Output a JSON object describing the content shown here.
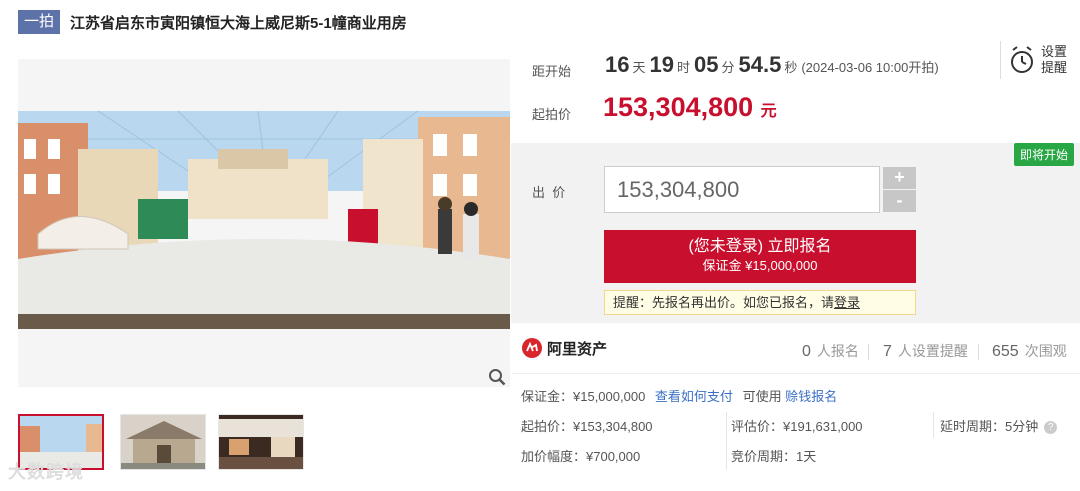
{
  "header": {
    "badge": "一拍",
    "title": "江苏省启东市寅阳镇恒大海上威尼斯5-1幢商业用房"
  },
  "countdown": {
    "label": "距开始",
    "days": "16",
    "days_unit": "天",
    "hours": "19",
    "hours_unit": "时",
    "minutes": "05",
    "minutes_unit": "分",
    "seconds": "54.5",
    "seconds_unit": "秒",
    "start_time": "(2024-03-06 10:00开拍)"
  },
  "start_price": {
    "label": "起拍价",
    "value": "153,304,800",
    "unit": "元"
  },
  "reminder": {
    "label_line1": "设置",
    "label_line2": "提醒",
    "icon": "alarm-clock-icon"
  },
  "bid": {
    "status_tag": "即将开始",
    "label": "出  价",
    "input_value": "153,304,800",
    "plus": "+",
    "minus": "-",
    "apply_main": "(您未登录) 立即报名",
    "apply_sub": "保证金 ¥15,000,000",
    "tip_text": "提醒：先报名再出价。如您已报名，请",
    "tip_link": "登录"
  },
  "brand": {
    "name": "阿里资产",
    "icon": "ali-asset-logo-icon"
  },
  "stats": {
    "applicants": "0",
    "applicants_label": "人报名",
    "reminders": "7",
    "reminders_label": "人设置提醒",
    "views": "655",
    "views_label": "次围观"
  },
  "details": {
    "deposit": "保证金：¥15,000,000",
    "how_to_pay": "查看如何支付",
    "usable": "可使用",
    "loan": "赊钱报名",
    "start_price": "起拍价：¥153,304,800",
    "assessed": "评估价：¥191,631,000",
    "delay": "延时周期：5分钟",
    "increment": "加价幅度：¥700,000",
    "bid_cycle": "竞价周期：1天"
  },
  "watermark": "大数跨境",
  "colors": {
    "accent": "#c8102e",
    "badge": "#5d72a8",
    "green": "#29a745",
    "link": "#3a6fc4"
  }
}
